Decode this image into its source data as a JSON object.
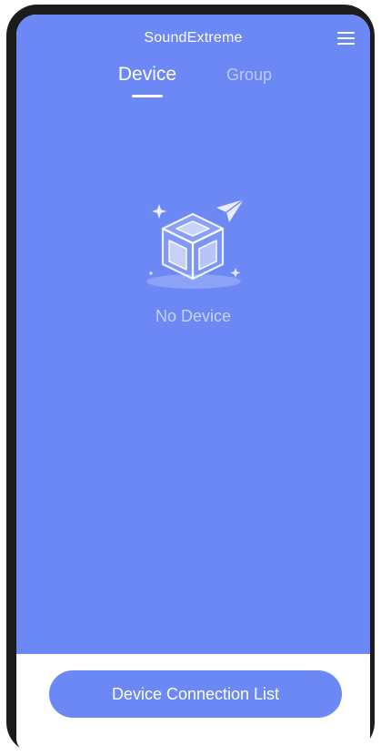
{
  "header": {
    "app_title": "SoundExtreme",
    "menu_icon": "hamburger-menu-icon"
  },
  "tabs": [
    {
      "label": "Device",
      "active": true
    },
    {
      "label": "Group",
      "active": false
    }
  ],
  "empty_state": {
    "icon": "empty-box-paper-plane-icon",
    "message": "No Device"
  },
  "footer": {
    "button_label": "Device Connection List"
  },
  "colors": {
    "accent": "#6c88f5",
    "frame": "#1c1c1e",
    "background": "#ffffff"
  }
}
